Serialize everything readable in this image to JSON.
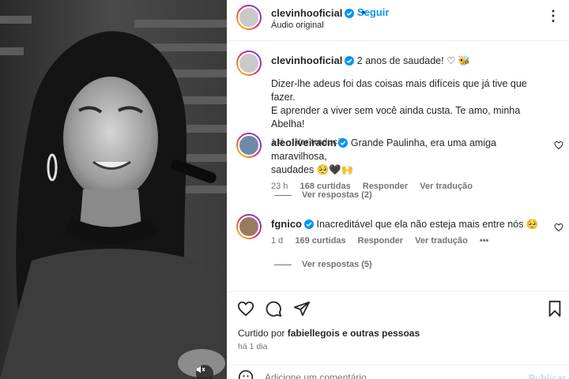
{
  "media": {
    "description_icon": "muted-speaker-icon"
  },
  "header": {
    "username": "clevinhooficial",
    "follow_label": "Seguir",
    "audio_label": "Áudio original",
    "more_icon": "more-options-icon"
  },
  "caption": {
    "username": "clevinhooficial",
    "text_line1": "2 anos de saudade! ♡ 🐝",
    "text_line2": "Dizer-lhe adeus foi das coisas mais difíceis que já tive que fazer.",
    "text_line3": "E aprender a viver sem você ainda custa. Te amo, minha Abelha!",
    "time": "1 d",
    "translate": "Ver tradução"
  },
  "comments": [
    {
      "username": "aleoliveiracm",
      "text_line1": "Grande Paulinha, era uma amiga maravilhosa,",
      "text_line2": "saudades 🥺🖤🙌",
      "time": "23 h",
      "likes": "168 curtidas",
      "reply": "Responder",
      "translate": "Ver tradução",
      "replies": "Ver respostas (2)"
    },
    {
      "username": "fgnico",
      "text_line1": "Inacreditável que ela não esteja mais entre nós 🥺",
      "time": "1 d",
      "likes": "169 curtidas",
      "reply": "Responder",
      "translate": "Ver tradução",
      "more": "•••",
      "replies": "Ver respostas (5)"
    }
  ],
  "likes_line": {
    "prefix": "Curtido por",
    "user": "fabiellegois",
    "suffix": "e outras pessoas"
  },
  "time_ago": "há 1 dia",
  "add_comment": {
    "placeholder": "Adicione um comentário...",
    "post_label": "Publicar"
  },
  "colors": {
    "accent": "#0095f6",
    "verified": "#0095f6",
    "muted": "#737373"
  }
}
